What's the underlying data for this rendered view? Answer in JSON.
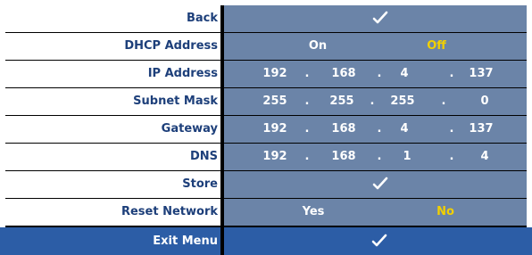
{
  "menu": {
    "back": {
      "label": "Back",
      "value_icon": "checkmark-icon"
    },
    "dhcp": {
      "label": "DHCP Address",
      "options": [
        "On",
        "Off"
      ],
      "selected": "Off",
      "highlight_color": "#f2d000"
    },
    "ip": {
      "label": "IP Address",
      "octets": [
        "192",
        "168",
        "4",
        "137"
      ],
      "dot": "."
    },
    "subnet": {
      "label": "Subnet Mask",
      "octets": [
        "255",
        "255",
        "255",
        "0"
      ],
      "dot": "."
    },
    "gateway": {
      "label": "Gateway",
      "octets": [
        "192",
        "168",
        "4",
        "137"
      ],
      "dot": "."
    },
    "dns": {
      "label": "DNS",
      "octets": [
        "192",
        "168",
        "1",
        "4"
      ],
      "dot": "."
    },
    "store": {
      "label": "Store",
      "value_icon": "checkmark-icon"
    },
    "reset": {
      "label": "Reset Network",
      "options": [
        "Yes",
        "No"
      ],
      "selected": "No"
    },
    "exit": {
      "label": "Exit Menu",
      "value_icon": "checkmark-icon"
    }
  },
  "colors": {
    "label_text": "#1d3f7a",
    "value_bg": "#6b84a8",
    "selected_bar": "#2c5da6",
    "highlight": "#f2d000"
  }
}
